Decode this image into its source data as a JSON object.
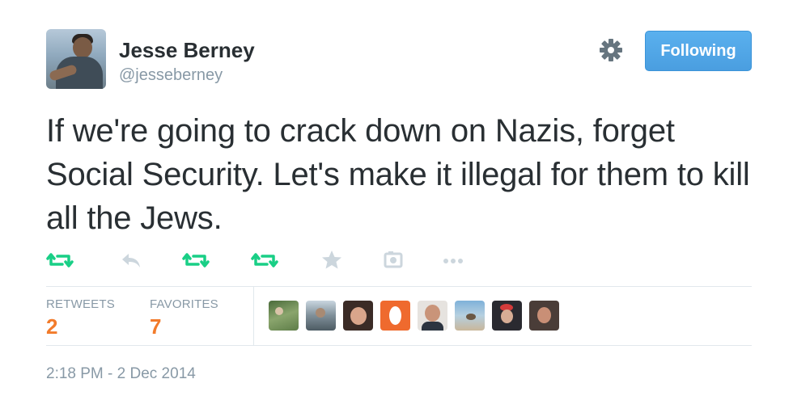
{
  "user": {
    "name": "Jesse Berney",
    "handle": "@jesseberney"
  },
  "follow_button": {
    "label": "Following"
  },
  "tweet": {
    "text": "If we're going to crack down on Nazis, forget Social Security. Let's make it illegal for them to kill all the Jews."
  },
  "action_icons": [
    "retweet-icon",
    "reply-icon",
    "retweet-icon",
    "retweet-icon",
    "star-icon",
    "photo-icon",
    "more-icon"
  ],
  "stats": {
    "retweets_label": "RETWEETS",
    "retweets_count": "2",
    "favorites_label": "FAVORITES",
    "favorites_count": "7"
  },
  "favoriters_count_shown": 8,
  "timestamp": "2:18 PM - 2 Dec 2014",
  "colors": {
    "accent_blue": "#55acee",
    "retweet_green": "#19cf86",
    "count_orange": "#f27b2b",
    "muted_gray": "#8899a6"
  }
}
